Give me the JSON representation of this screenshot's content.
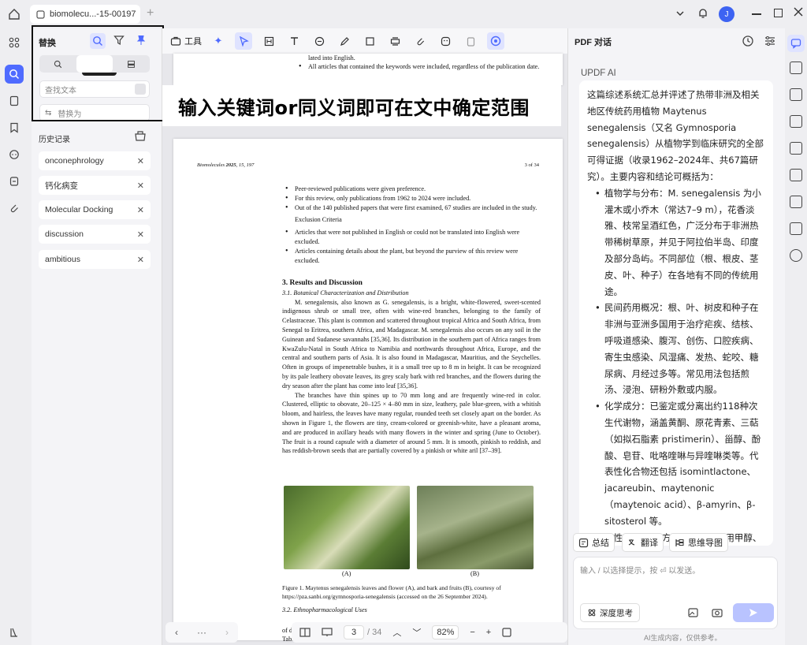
{
  "titlebar": {
    "tab_label": "biomolecu...-15-00197",
    "add_tab": "+",
    "avatar_letter": "J"
  },
  "search_panel": {
    "title": "替换",
    "tooltip": "AI 搜索",
    "find_placeholder": "查找文本",
    "replace_placeholder": "替换为",
    "history_title": "历史记录",
    "history": [
      "onconephrology",
      "钙化病变",
      "Molecular Docking",
      "discussion",
      "ambitious"
    ]
  },
  "toolbar": {
    "tools_label": "工具"
  },
  "overlay_caption": "输入关键词or同义词即可在文中确定范围",
  "page_top": {
    "line1": "lated into English.",
    "bullet": "All articles that contained the keywords were included, regardless of the publication date."
  },
  "page": {
    "journal": "Biomolecules",
    "year": "2025",
    "volref": ", 15, 197",
    "pageno": "3 of 34",
    "bullets1": [
      "Peer-reviewed publications were given preference.",
      "For this review, only publications from 1962 to 2024 were included.",
      "Out of the 140 published papers that were first examined, 67 studies are included in the study."
    ],
    "exclusion": "Exclusion Criteria",
    "bullets2": [
      "Articles that were not published in English or could not be translated into English were excluded.",
      "Articles containing details about the plant, but beyond the purview of this review were excluded."
    ],
    "section": "3. Results and Discussion",
    "subsection1": "3.1. Botanical Characterization and Distribution",
    "para1": "M. senegalensis, also known as G. senegalensis, is a bright, white-flowered, sweet-scented indigenous shrub or small tree, often with wine-red branches, belonging to the family of Celastraceae. This plant is common and scattered throughout tropical Africa and South Africa, from Senegal to Eritrea, southern Africa, and Madagascar. M. senegalensis also occurs on any soil in the Guinean and Sudanese savannahs [35,36]. Its distribution in the southern part of Africa ranges from KwaZulu-Natal in South Africa to Namibia and northwards throughout Africa, Europe, and the central and southern parts of Asia. It is also found in Madagascar, Mauritius, and the Seychelles. Often in groups of impenetrable bushes, it is a small tree up to 8 m in height. It can be recognized by its pale leathery obovate leaves, its grey scaly bark with red branches, and the flowers during the dry season after the plant has come into leaf [35,36].",
    "para2": "The branches have thin spines up to 70 mm long and are frequently wine-red in color. Clustered, elliptic to obovate, 20–125 × 4–80 mm in size, leathery, pale blue-green, with a whitish bloom, and hairless, the leaves have many regular, rounded teeth set closely apart on the border. As shown in Figure 1, the flowers are tiny, cream-colored or greenish-white, have a pleasant aroma, and are produced in axillary heads with many flowers in the winter and spring (June to October). The fruit is a round capsule with a diameter of around 5 mm. It is smooth, pinkish to reddish, and has reddish-brown seeds that are partially covered by a pinkish or white aril [37–39].",
    "fig_a": "(A)",
    "fig_b": "(B)",
    "caption": "Figure 1. Maytenus senegalensis leaves and flower (A), and bark and fruits (B), courtesy of https://pza.sanbi.org/gymnosporia-senegalensis (accessed on the 26 September 2024).",
    "subsection2": "3.2. Ethnopharmacological Uses",
    "trail1": "of d",
    "trail2": "Tabl"
  },
  "bottom_bar": {
    "page_current": "3",
    "page_total": "/ 34",
    "zoom": "82%"
  },
  "right_panel": {
    "title": "PDF 对话",
    "ai_label": "UPDF AI",
    "intro": "这篇综述系统汇总并评述了热带非洲及相关地区传统药用植物 Maytenus senegalensis（又名 Gymnosporia senegalensis）从植物学到临床研究的全部可得证据（收录1962–2024年、共67篇研究）。主要内容和结论可概括为：",
    "points": [
      "植物学与分布：M. senegalensis 为小灌木或小乔木（常达7–9 m），花香淡雅、枝常呈酒红色，广泛分布于非洲热带稀树草原，并见于阿拉伯半岛、印度及部分岛屿。不同部位（根、根皮、茎皮、叶、种子）在各地有不同的传统用途。",
      "民间药用概况：根、叶、树皮和种子在非洲与亚洲多国用于治疗疟疾、结核、呼吸道感染、腹泻、创伤、口腔疾病、寄生虫感染、风湿痛、发热、蛇咬、糖尿病、月经过多等。常见用法包括煎汤、浸泡、研粉外敷或内服。",
      "化学成分：已鉴定或分离出约118种次生代谢物，涵盖黄酮、原花青素、三萜（如拟石脂素 pristimerin）、甾醇、酚酸、皂苷、吡咯喹啉与异喹啉类等。代表性化合物还包括 isomintlactone、jacareubin、maytenonic（maytenoic acid）、β-amyrin、β-sitosterol 等。",
      "定性/定量分析方法与发现：采用甲醇、乙醇、水、石油醚等不同溶剂提取，并用 GC–MS、HPLC-ESI-MSn、NMR"
    ],
    "chips": [
      "总结",
      "翻译",
      "思维导图"
    ],
    "input_placeholder": "输入 / 以选择提示，按 ⏎ 以发送。",
    "deep_think": "深度思考",
    "disclaimer": "AI生成内容，仅供参考。"
  },
  "colors": {
    "accent": "#4f6bff",
    "overlay_text": "#000000"
  }
}
